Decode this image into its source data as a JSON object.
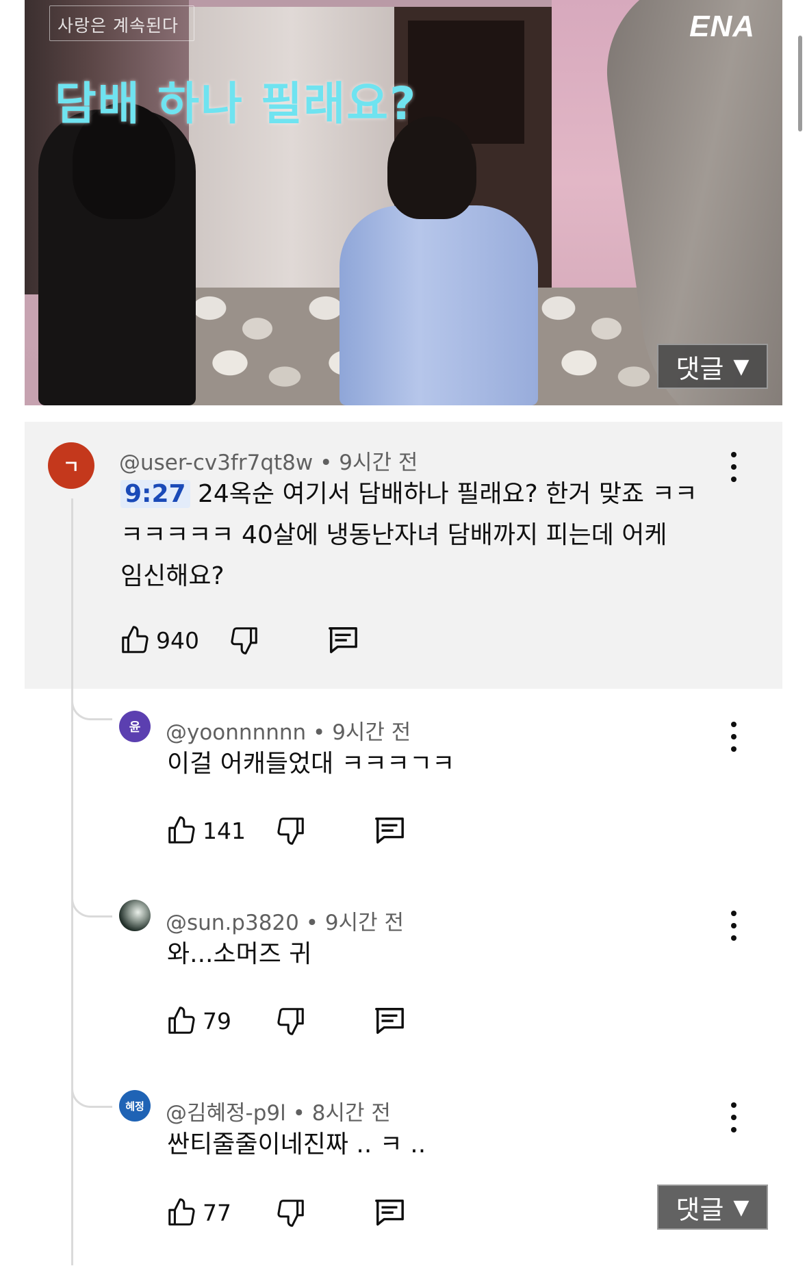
{
  "video": {
    "program_label": "사랑은 계속된다",
    "channel_logo": "ENA",
    "subtitle": "담배 하나 필래요?"
  },
  "comments_button": {
    "label": "댓글",
    "arrow": "▼"
  },
  "main_comment": {
    "avatar_initial": "ㄱ",
    "avatar_color": "#c4381c",
    "author": "@user-cv3fr7qt8w",
    "separator": "•",
    "time": "9시간 전",
    "timestamp": "9:27",
    "text_line1": "24옥순 여기서 담배하나 필래요? 한거 맞죠 ㅋㅋ",
    "text_line2": "ㅋㅋㅋㅋㅋ 40살에 냉동난자녀 담배까지 피는데 어케",
    "text_line3": "임신해요?",
    "likes": "940"
  },
  "replies": [
    {
      "avatar_initial": "윤",
      "avatar_color": "#5b3fb0",
      "author": "@yoonnnnnn",
      "time": "9시간 전",
      "text": "이걸 어캐들었대 ㅋㅋㅋㄱㅋ",
      "likes": "141"
    },
    {
      "avatar_initial": "",
      "avatar_color": "#2b3a33",
      "author": "@sun.p3820",
      "time": "9시간 전",
      "text": "와...소머즈 귀",
      "likes": "79"
    },
    {
      "avatar_initial": "혜정",
      "avatar_color": "#1f63b5",
      "author": "@김혜정-p9l",
      "time": "8시간 전",
      "text": "싼티줄줄이네진짜 .. ㅋ ..",
      "likes": "77"
    }
  ],
  "icons": {
    "like": "thumbs-up-icon",
    "dislike": "thumbs-down-icon",
    "reply": "reply-icon",
    "more": "more-vert-icon"
  }
}
